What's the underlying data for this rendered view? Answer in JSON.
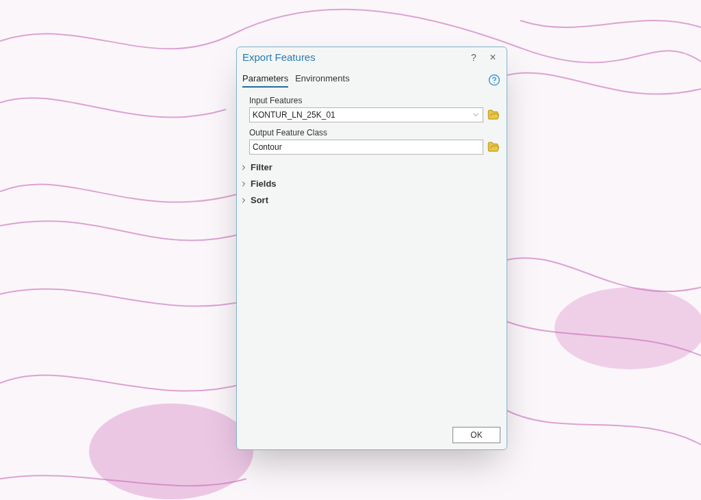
{
  "dialog": {
    "title": "Export Features",
    "help_button": "?",
    "close_button": "×",
    "tabs": [
      {
        "label": "Parameters",
        "selected": true
      },
      {
        "label": "Environments",
        "selected": false
      }
    ],
    "parameters": [
      {
        "label": "Input Features",
        "value": "KONTUR_LN_25K_01",
        "kind": "dropdown"
      },
      {
        "label": "Output Feature Class",
        "value": "Contour",
        "kind": "text"
      }
    ],
    "sections": [
      {
        "label": "Filter",
        "expanded": false
      },
      {
        "label": "Fields",
        "expanded": false
      },
      {
        "label": "Sort",
        "expanded": false
      }
    ],
    "ok_button": "OK"
  }
}
